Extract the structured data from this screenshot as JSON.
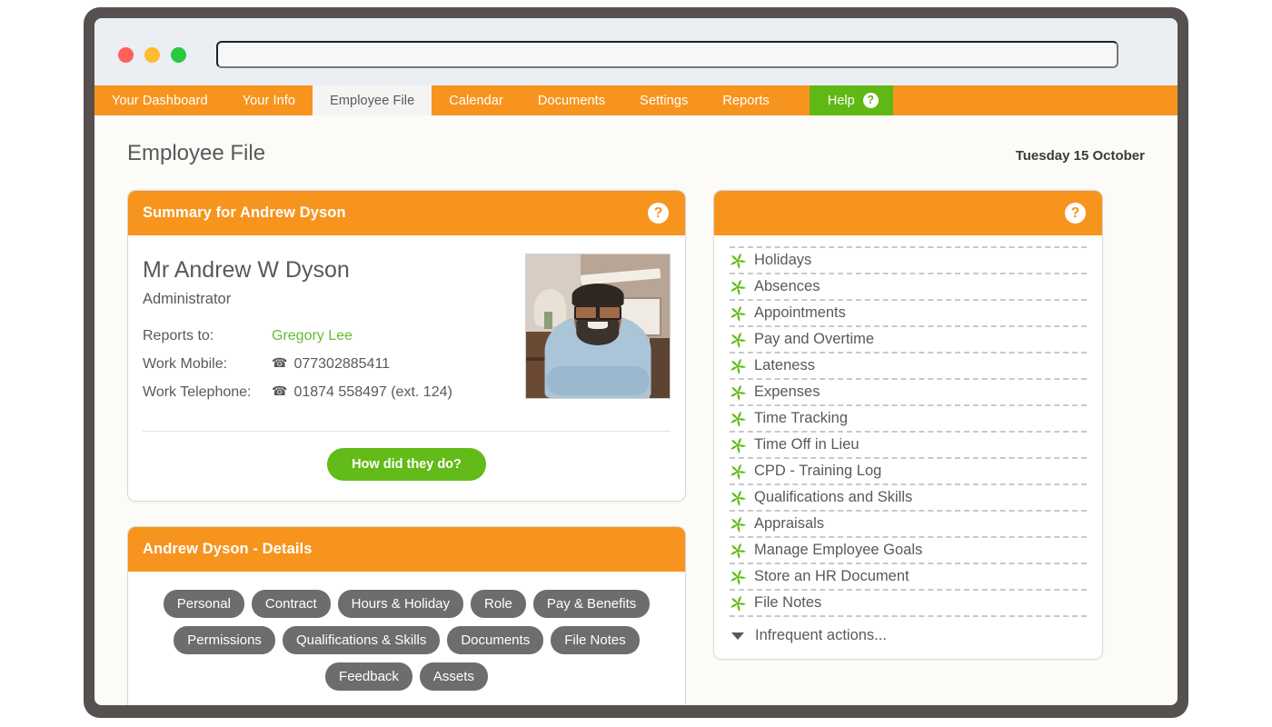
{
  "browser": {
    "traffic_lights": [
      {
        "name": "close",
        "color": "#ff6058"
      },
      {
        "name": "minimize",
        "color": "#febc2e"
      },
      {
        "name": "zoom",
        "color": "#2ac83f"
      }
    ],
    "address_value": "",
    "address_placeholder": ""
  },
  "nav": {
    "items": [
      {
        "label": "Your Dashboard",
        "active": false
      },
      {
        "label": "Your Info",
        "active": false
      },
      {
        "label": "Employee File",
        "active": true
      },
      {
        "label": "Calendar",
        "active": false
      },
      {
        "label": "Documents",
        "active": false
      },
      {
        "label": "Settings",
        "active": false
      },
      {
        "label": "Reports",
        "active": false
      }
    ],
    "help_label": "Help",
    "help_badge": "?",
    "bar_color": "#f7941e",
    "help_color": "#5fb814"
  },
  "header": {
    "title": "Employee File",
    "date": "Tuesday 15 October"
  },
  "summary_card": {
    "title": "Summary for Andrew Dyson",
    "help_badge": "?",
    "employee_name": "Mr Andrew W Dyson",
    "employee_role": "Administrator",
    "details": [
      {
        "label": "Reports to:",
        "value": "Gregory Lee",
        "is_link": true,
        "has_phone_icon": false
      },
      {
        "label": "Work Mobile:",
        "value": "077302885411",
        "is_link": false,
        "has_phone_icon": true
      },
      {
        "label": "Work Telephone:",
        "value": "01874 558497 (ext. 124)",
        "is_link": false,
        "has_phone_icon": true
      }
    ],
    "button_label": "How did they do?",
    "button_color": "#62bb18",
    "link_color": "#66bb33"
  },
  "details_card": {
    "title": "Andrew Dyson - Details",
    "help_badge": "",
    "pills": [
      "Personal",
      "Contract",
      "Hours & Holiday",
      "Role",
      "Pay & Benefits",
      "Permissions",
      "Qualifications & Skills",
      "Documents",
      "File Notes",
      "Feedback",
      "Assets"
    ],
    "pill_color": "#6d6d6d"
  },
  "actions_card": {
    "title": "",
    "help_badge": "?",
    "items": [
      "Holidays",
      "Absences",
      "Appointments",
      "Pay and Overtime",
      "Lateness",
      "Expenses",
      "Time Tracking",
      "Time Off in Lieu",
      "CPD - Training Log",
      "Qualifications and Skills",
      "Appraisals",
      "Manage Employee Goals",
      "Store an HR Document",
      "File Notes"
    ],
    "infrequent_label": "Infrequent actions...",
    "icon_color": "#5fbb14"
  }
}
